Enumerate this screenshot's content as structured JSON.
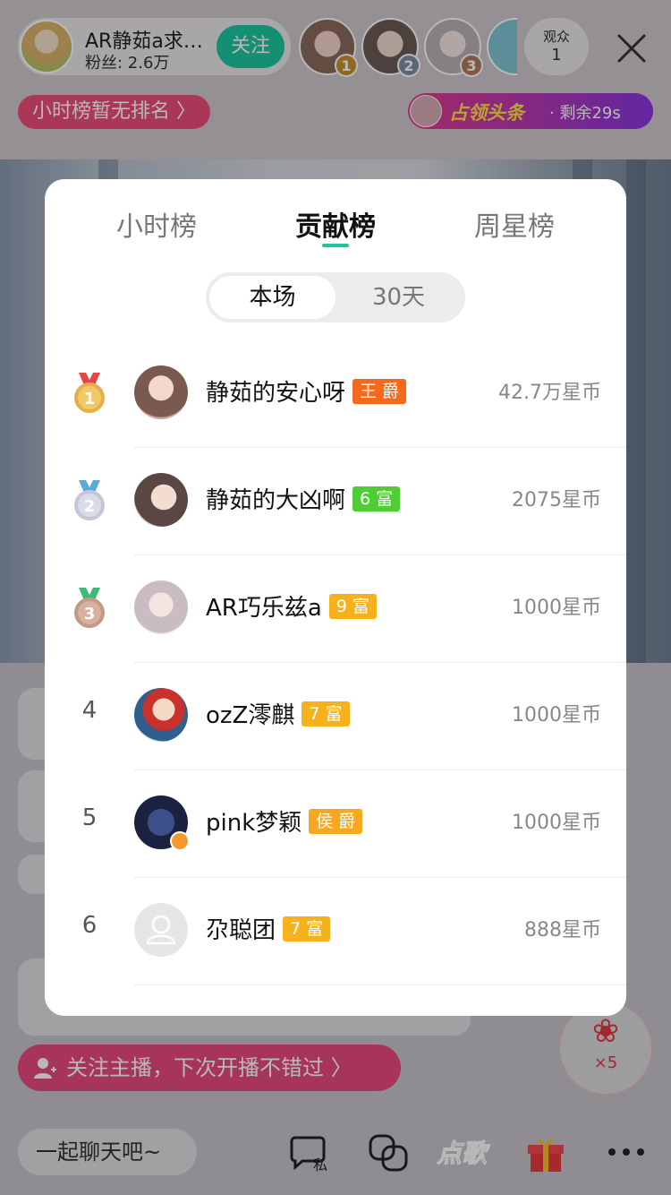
{
  "header": {
    "anchor_name": "AR静茹a求…",
    "fans": "粉丝: 2.6万",
    "follow_label": "关注",
    "top_viewers": [
      {
        "rank": "1",
        "color": "#c8902a"
      },
      {
        "rank": "2",
        "color": "#7e8fa6"
      },
      {
        "rank": "3",
        "color": "#b17a5a"
      }
    ],
    "viewers_label": "观众",
    "viewers_count": "1"
  },
  "hour_rank_status": "小时榜暂无排名 〉",
  "headline": {
    "text": "占领头条",
    "remaining": "· 剩余29s"
  },
  "follow_cta": "关注主播，下次开播不错过 〉",
  "gift": {
    "count": "×5"
  },
  "toolbar": {
    "chat_placeholder": "一起聊天吧~",
    "dian_ge": "点歌"
  },
  "modal": {
    "tabs": [
      "小时榜",
      "贡献榜",
      "周星榜"
    ],
    "active_tab": "贡献榜",
    "segments": [
      "本场",
      "30天"
    ],
    "active_segment": "本场",
    "rows": [
      {
        "rank": "1",
        "name": "静茹的安心呀",
        "badge": "王 爵",
        "badge_color": "#f36a1f",
        "coins": "42.7万星币"
      },
      {
        "rank": "2",
        "name": "静茹的大凶啊",
        "badge": "6 富",
        "badge_color": "#4fcd34",
        "coins": "2075星币"
      },
      {
        "rank": "3",
        "name": "AR巧乐兹a",
        "badge": "9 富",
        "badge_color": "#f7b11b",
        "coins": "1000星币"
      },
      {
        "rank": "4",
        "name": "ozZ澪麒",
        "badge": "7 富",
        "badge_color": "#f7b11b",
        "coins": "1000星币"
      },
      {
        "rank": "5",
        "name": "pink梦颖",
        "badge": "侯 爵",
        "badge_color": "#f7a81e",
        "coins": "1000星币"
      },
      {
        "rank": "6",
        "name": "尕聪团",
        "badge": "7 富",
        "badge_color": "#f7b11b",
        "coins": "888星币"
      }
    ]
  },
  "colors": {
    "accent": "#1ec6a0",
    "pink": "#ee4d7a"
  }
}
